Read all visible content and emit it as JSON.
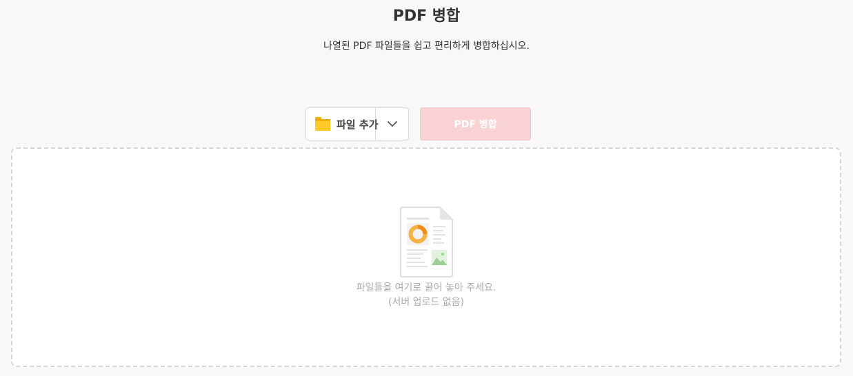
{
  "header": {
    "title": "PDF 병합",
    "subtitle": "나열된 PDF 파일들을 쉽고 편리하게 병합하십시오."
  },
  "toolbar": {
    "add_file_label": "파일 추가",
    "add_file_icon": "folder-icon",
    "dropdown_icon": "chevron-down-icon",
    "merge_label": "PDF 병합",
    "merge_enabled": false
  },
  "drop_zone": {
    "icon": "document-icon",
    "line1": "파일들을 여기로 끌어 놓아 주세요.",
    "line2": "(서버 업로드 없음)"
  },
  "colors": {
    "folder": "#ffc107",
    "merge_disabled_bg": "#f9d3d3",
    "chart_orange": "#f5b342",
    "image_green": "#a8d5a2"
  }
}
